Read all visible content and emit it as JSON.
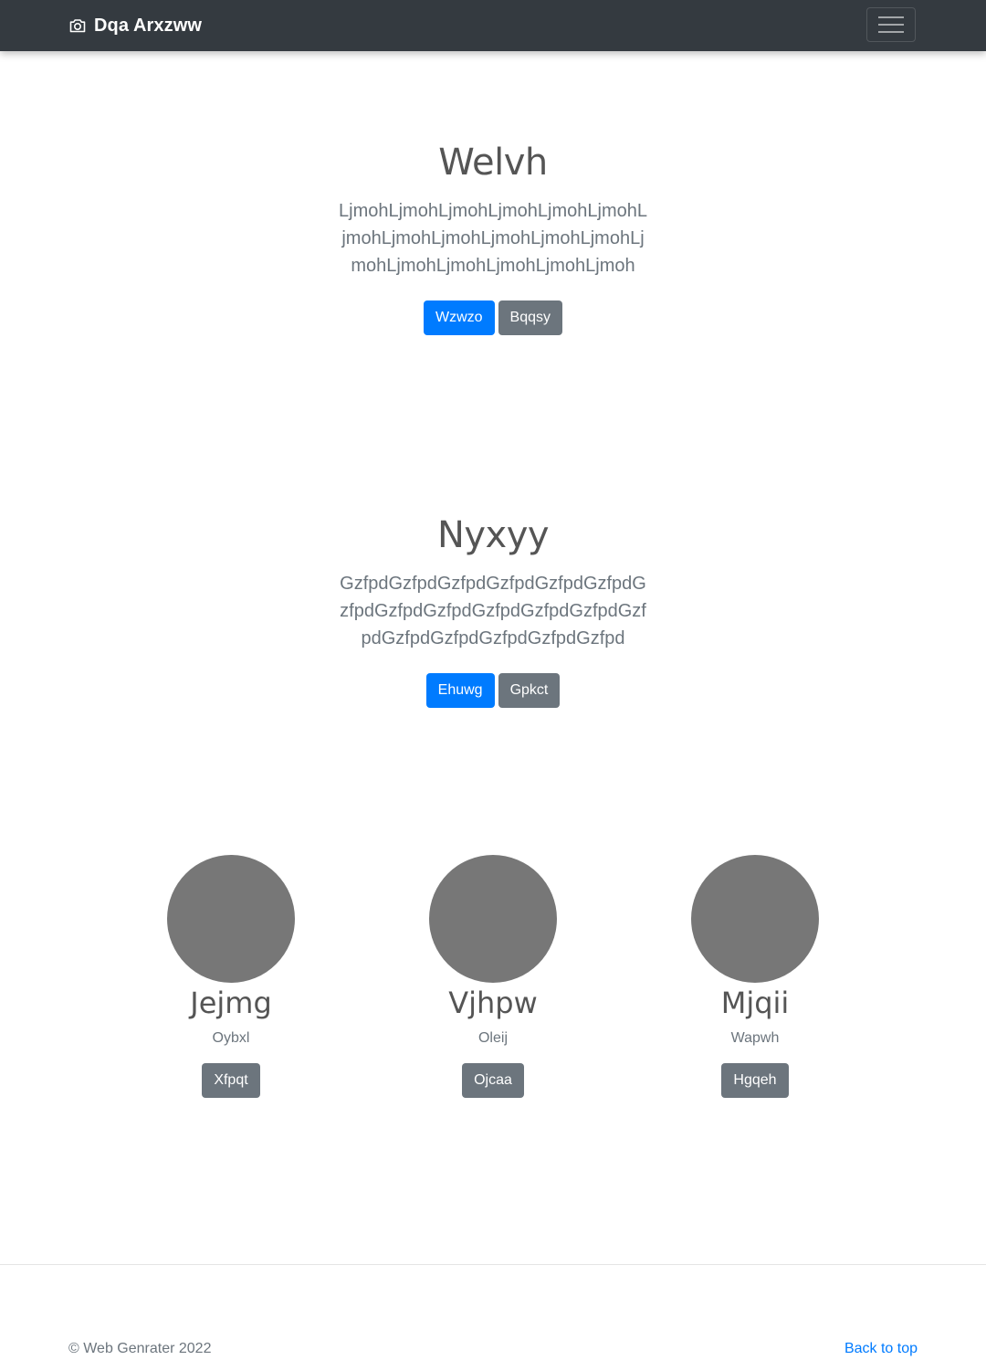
{
  "navbar": {
    "brand_icon": "camera-icon",
    "brand": "Dqa Arxzww",
    "toggler_icon": "hamburger-menu-icon"
  },
  "hero1": {
    "title": "Welvh",
    "lead": "LjmohLjmohLjmohLjmohLjmohLjmohLjmohLjmohLjmohLjmohLjmohLjmohLjmohLjmohLjmohLjmohLjmohLjmoh",
    "primary_button": "Wzwzo",
    "secondary_button": "Bqqsy"
  },
  "hero2": {
    "title": "Nyxyy",
    "lead": "GzfpdGzfpdGzfpdGzfpdGzfpdGzfpdGzfpdGzfpdGzfpdGzfpdGzfpdGzfpdGzfpdGzfpdGzfpdGzfpdGzfpdGzfpd",
    "primary_button": "Ehuwg",
    "secondary_button": "Gpkct"
  },
  "team": [
    {
      "name": "Jejmg",
      "role": "Oybxl",
      "button": "Xfpqt"
    },
    {
      "name": "Vjhpw",
      "role": "Oleij",
      "button": "Ojcaa"
    },
    {
      "name": "Mjqii",
      "role": "Wapwh",
      "button": "Hgqeh"
    }
  ],
  "footer": {
    "copyright": "© Web Genrater 2022",
    "back_to_top": "Back to top"
  },
  "colors": {
    "navbar_bg": "#343a40",
    "primary": "#007bff",
    "secondary": "#6c757d",
    "avatar_placeholder": "#777777"
  }
}
